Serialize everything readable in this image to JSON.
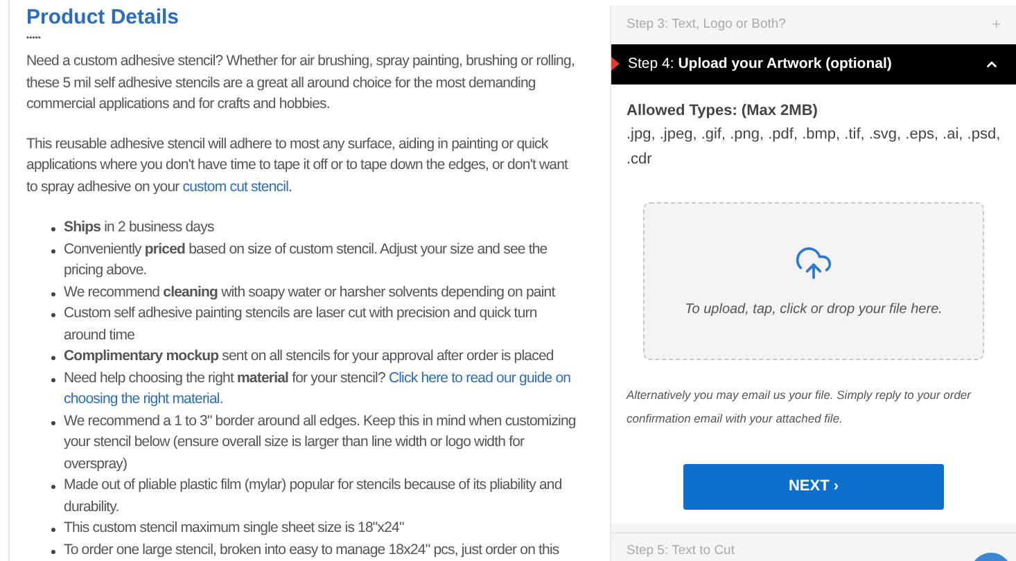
{
  "details": {
    "title": "Product Details",
    "rating_mark": "•••••",
    "paragraphs": [
      [
        {
          "kind": "text",
          "text": "Need a custom adhesive stencil? Whether for air brushing, spray painting, brushing or rolling, these 5 mil self adhesive stencils are a great all around choice for the most demanding commercial applications and for crafts and hobbies."
        }
      ],
      [
        {
          "kind": "text",
          "text": "This reusable adhesive stencil will adhere to most any surface, aiding in painting or quick applications where you don't have time to tape it off or to tape down the edges, or don't want to spray adhesive on your "
        },
        {
          "kind": "link",
          "text": "custom cut stencil"
        },
        {
          "kind": "text",
          "text": "."
        }
      ]
    ],
    "bullets": [
      [
        {
          "kind": "text",
          "text": "**Ships** in 2 business days"
        }
      ],
      [
        {
          "kind": "text",
          "text": "Conveniently **priced** based on size of custom stencil. Adjust your size and see the pricing above."
        }
      ],
      [
        {
          "kind": "text",
          "text": "We recommend **cleaning** with soapy water or harsher solvents depending on paint"
        }
      ],
      [
        {
          "kind": "text",
          "text": "Custom self adhesive painting stencils are laser cut with precision and quick turn around time"
        }
      ],
      [
        {
          "kind": "text",
          "text": "**Complimentary mockup** sent on all stencils for your approval after order is placed"
        }
      ],
      [
        {
          "kind": "text",
          "text": "Need help choosing the right **material** for your stencil? "
        },
        {
          "kind": "link",
          "text": "Click here to read our guide on"
        },
        {
          "kind": "link",
          "text": "choosing the right material."
        }
      ],
      [
        {
          "kind": "text",
          "text": "We recommend a 1 to 3\" border around all edges. Keep this in mind when customizing your stencil below (ensure overall size is larger than line width or logo width for overspray)"
        }
      ],
      [
        {
          "kind": "text",
          "text": "Made out of pliable plastic film (mylar) popular for stencils because of its pliability and durability."
        }
      ],
      [
        {
          "kind": "text",
          "text": "This custom stencil maximum single sheet size is 18\"x24\""
        }
      ],
      [
        {
          "kind": "text",
          "text": "To order one large stencil, broken into easy to manage 18x24\" pcs, just order on this"
        }
      ]
    ]
  },
  "steps": [
    {
      "label": "Step 3: Text, Logo or Both?",
      "expanded": false,
      "toggle": "+"
    },
    {
      "label": "Step 4: **Upload your Artwork (optional)**",
      "expanded": true,
      "allowed_title": "Allowed Types: (Max 2MB)",
      "allowed_types": ".jpg, .jpeg, .gif, .png, .pdf, .bmp, .tif, .svg, .eps, .ai, .psd, .cdr",
      "drop_hint": "To upload, tap, click or drop your file here.",
      "note": "Alternatively you may email us your file. Simply reply to your order confirmation email with your attached file.",
      "button": "NEXT ›"
    },
    {
      "label": "Step 5: Text to Cut",
      "expanded": false
    }
  ]
}
